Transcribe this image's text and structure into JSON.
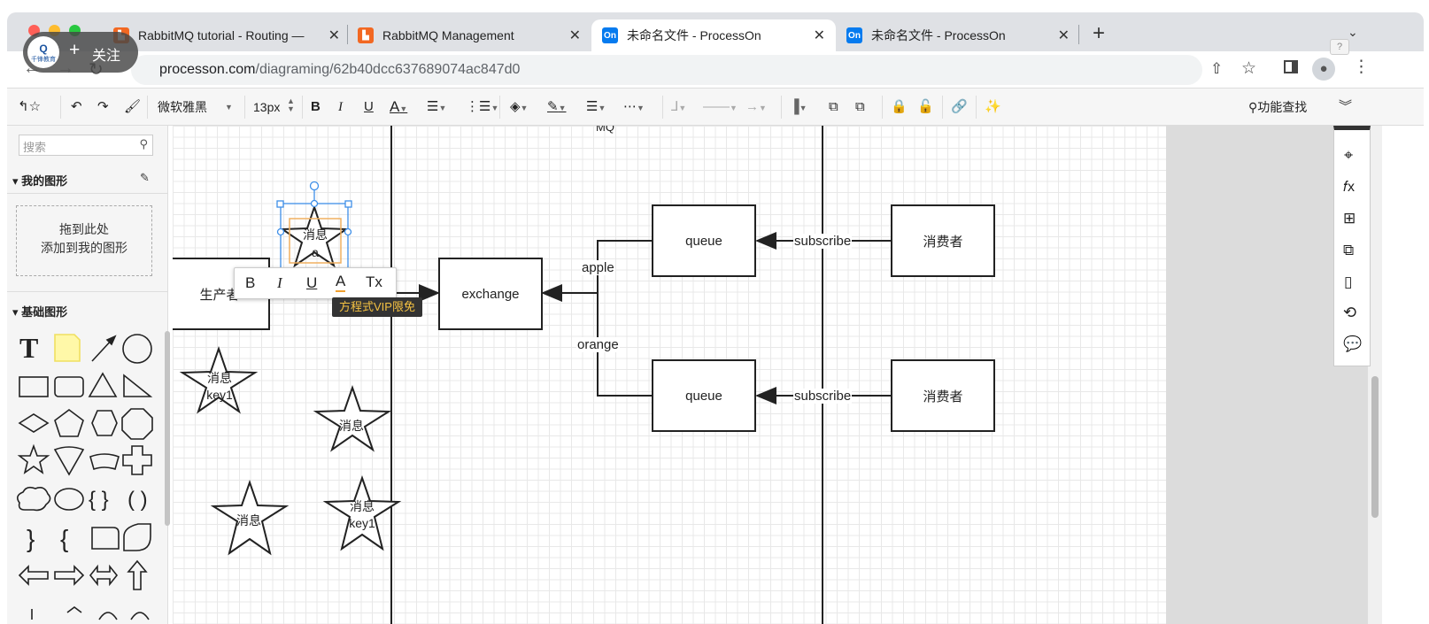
{
  "window": {
    "title_tabs": [
      {
        "label": "RabbitMQ tutorial - Routing —  ",
        "favicon": "rabbitmq-icon",
        "color": "#f26822"
      },
      {
        "label": "RabbitMQ Management",
        "favicon": "rabbitmq-icon",
        "color": "#f26822"
      },
      {
        "label": "未命名文件 - ProcessOn",
        "favicon": "processon-icon",
        "color": "#067bef",
        "active": true
      },
      {
        "label": "未命名文件 - ProcessOn",
        "favicon": "processon-icon",
        "color": "#067bef"
      }
    ]
  },
  "overlay": {
    "follow_label": "关注",
    "logo_text": "千锋教育"
  },
  "address": {
    "host": "processon.com",
    "path": "/diagraming/62b40dcc637689074ac847d0"
  },
  "toolbar": {
    "font": "微软雅黑",
    "size": "13px",
    "feature_search": "功能查找"
  },
  "left_panel": {
    "search_placeholder": "搜索",
    "my_shapes": "我的图形",
    "drop_line1": "拖到此处",
    "drop_line2": "添加到我的图形",
    "basic_shapes": "基础图形"
  },
  "diagram": {
    "mq_label": "MQ",
    "producer": "生产者",
    "exchange": "exchange",
    "queue1": "queue",
    "queue2": "queue",
    "consumer1": "消费者",
    "consumer2": "消费者",
    "edge_apple": "apple",
    "edge_orange": "orange",
    "subscribe1": "subscribe",
    "subscribe2": "subscribe",
    "star_selected_l1": "消息",
    "star_selected_l2": "a",
    "star1_l1": "消息",
    "star1_l2": "key1",
    "star2": "消息",
    "star3": "消息",
    "star4_l1": "消息",
    "star4_l2": "key1",
    "vip_tooltip": "方程式VIP限免"
  }
}
